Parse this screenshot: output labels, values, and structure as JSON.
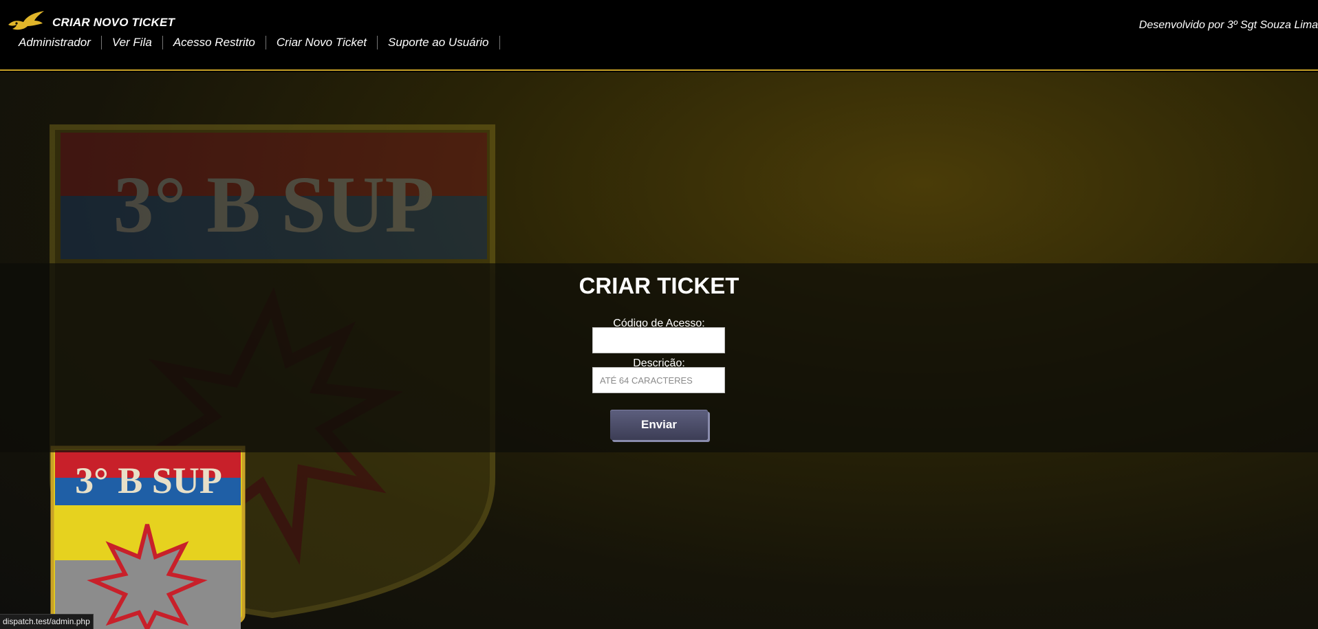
{
  "header": {
    "title": "CRIAR NOVO TICKET",
    "credit": "Desenvolvido por 3º Sgt Souza Lima",
    "nav": [
      {
        "label": "Administrador"
      },
      {
        "label": "Ver Fila"
      },
      {
        "label": "Acesso Restrito"
      },
      {
        "label": "Criar Novo Ticket"
      },
      {
        "label": "Suporte ao Usuário"
      }
    ],
    "logo_icon": "golden-eagle-icon"
  },
  "background": {
    "emblem_text": "3° B SUP",
    "emblem_icon": "explosion-star-icon",
    "colors": {
      "red": "#c8202a",
      "blue": "#1f5fa6",
      "yellow": "#e6d21f",
      "gray": "#8c8c8c",
      "gold": "#c9a227"
    }
  },
  "form": {
    "title": "CRIAR TICKET",
    "access_code_label": "Código de Acesso:",
    "access_code_value": "",
    "description_label": "Descrição:",
    "description_placeholder": "ATÉ 64 CARACTERES",
    "submit_label": "Enviar"
  },
  "status_bar": {
    "url": "dispatch.test/admin.php"
  }
}
